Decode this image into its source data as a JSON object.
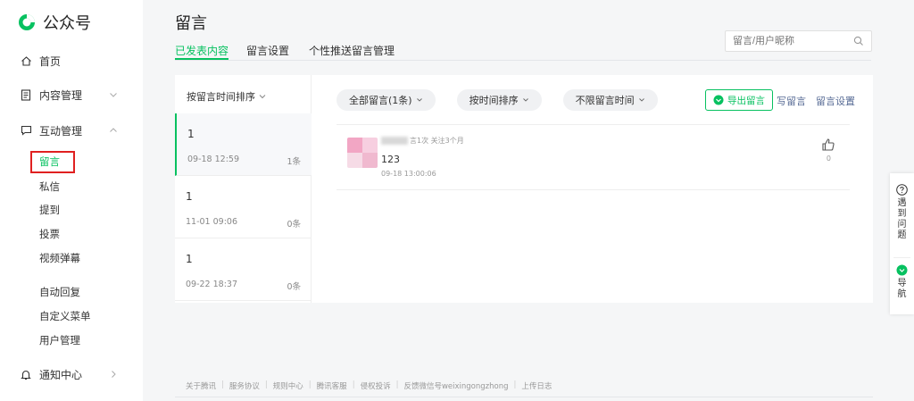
{
  "brand": {
    "name": "公众号",
    "accent": "#07c160",
    "link_color": "#576b95",
    "highlight_box": "#e02020"
  },
  "sidebar": {
    "home": {
      "label": "首页",
      "icon": "home-icon"
    },
    "content": {
      "label": "内容管理",
      "icon": "document-icon"
    },
    "interaction": {
      "label": "互动管理",
      "icon": "chat-bubble-icon"
    },
    "sub_items": [
      "留言",
      "私信",
      "提到",
      "投票",
      "视频弹幕",
      "自动回复",
      "自定义菜单",
      "用户管理"
    ],
    "notifications": {
      "label": "通知中心",
      "icon": "bell-icon"
    }
  },
  "header": {
    "title": "留言",
    "tabs": [
      "已发表内容",
      "留言设置",
      "个性推送留言管理"
    ],
    "search_placeholder": "留言/用户昵称"
  },
  "list": {
    "sort_label": "按留言时间排序",
    "articles": [
      {
        "title": "1",
        "date": "09-18 12:59",
        "count": "1条"
      },
      {
        "title": "1",
        "date": "11-01 09:06",
        "count": "0条"
      },
      {
        "title": "1",
        "date": "09-22 18:37",
        "count": "0条"
      }
    ]
  },
  "toolbar": {
    "filters": [
      "全部留言(1条)",
      "按时间排序",
      "不限留言时间"
    ],
    "export_label": "导出留言",
    "write_label": "写留言",
    "settings_label": "留言设置"
  },
  "comment": {
    "meta": "言1次 关注3个月",
    "text": "123",
    "time": "09-18 13:00:06",
    "likes": "0"
  },
  "footer": {
    "links": [
      "关于腾讯",
      "服务协议",
      "规则中心",
      "腾讯客服",
      "侵权投诉",
      "反馈微信号weixingongzhong",
      "上传日志"
    ]
  },
  "floating": {
    "help_label": "遇到问题",
    "nav_label": "导航"
  }
}
